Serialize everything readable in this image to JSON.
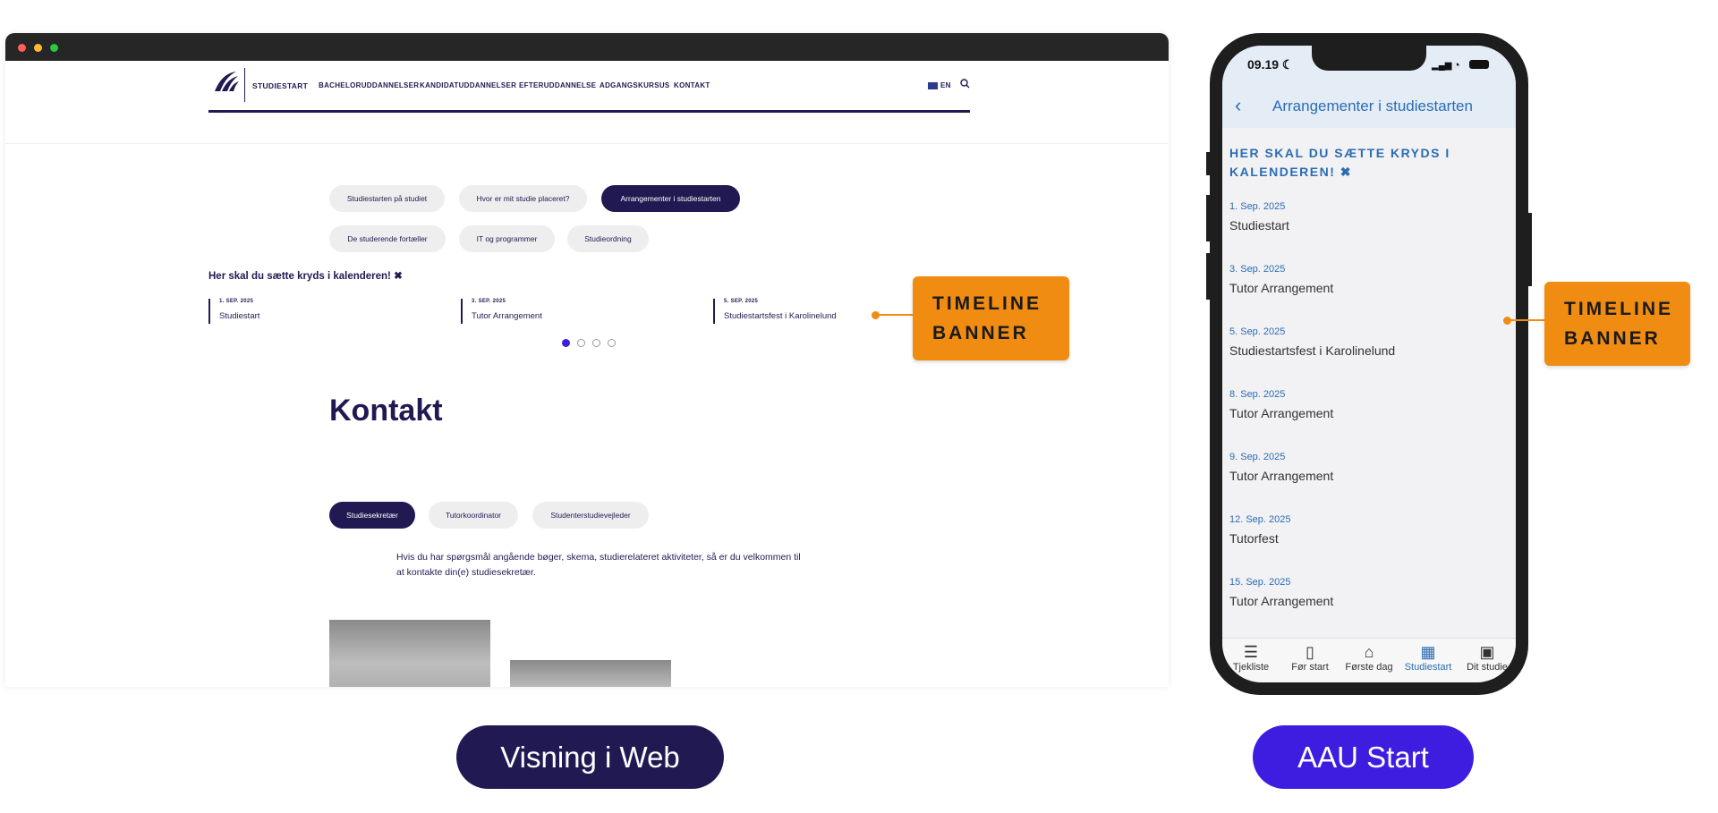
{
  "web": {
    "nav": {
      "brand": "STUDIESTART",
      "items": [
        "BACHELORUDDANNELSER",
        "KANDIDATUDDANNELSER",
        "EFTERUDDANNELSE",
        "ADGANGSKURSUS",
        "KONTAKT"
      ],
      "lang": "EN"
    },
    "pills": [
      "Studiestarten på studiet",
      "Hvor er mit studie placeret?",
      "Arrangementer i studiestarten",
      "De studerende fortæller",
      "IT og programmer",
      "Studieordning"
    ],
    "timeline": {
      "heading": "Her skal du sætte kryds i kalenderen! ✖",
      "items": [
        {
          "date": "1. SEP. 2025",
          "title": "Studiestart"
        },
        {
          "date": "3. SEP. 2025",
          "title": "Tutor Arrangement"
        },
        {
          "date": "5. SEP. 2025",
          "title": "Studiestartsfest i Karolinelund"
        }
      ]
    },
    "contact": {
      "title": "Kontakt",
      "tabs": [
        "Studiesekretær",
        "Tutorkoordinator",
        "Studenterstudievejleder"
      ],
      "text": "Hvis du har spørgsmål angående bøger, skema, studierelateret aktiviteter, så er du velkommen til at kontakte din(e) studiesekretær."
    }
  },
  "callout": {
    "line1": "TIMELINE",
    "line2": "BANNER"
  },
  "phone": {
    "time": "09.19",
    "title": "Arrangementer i studiestarten",
    "heading": "HER SKAL DU SÆTTE KRYDS I KALENDEREN! ✖",
    "events": [
      {
        "date": "1. Sep. 2025",
        "title": "Studiestart"
      },
      {
        "date": "3. Sep. 2025",
        "title": "Tutor Arrangement"
      },
      {
        "date": "5. Sep. 2025",
        "title": "Studiestartsfest i Karolinelund"
      },
      {
        "date": "8. Sep. 2025",
        "title": "Tutor Arrangement"
      },
      {
        "date": "9. Sep. 2025",
        "title": "Tutor Arrangement"
      },
      {
        "date": "12. Sep. 2025",
        "title": "Tutorfest"
      },
      {
        "date": "15. Sep. 2025",
        "title": "Tutor Arrangement"
      }
    ],
    "tabs": [
      "Tjekliste",
      "Før start",
      "Første dag",
      "Studiestart",
      "Dit studie"
    ]
  },
  "labels": {
    "web": "Visning i Web",
    "app": "AAU Start"
  },
  "colors": {
    "navy": "#211a52",
    "orange": "#f08c11",
    "blue": "#2b6cb4",
    "purple": "#3f1de0"
  }
}
